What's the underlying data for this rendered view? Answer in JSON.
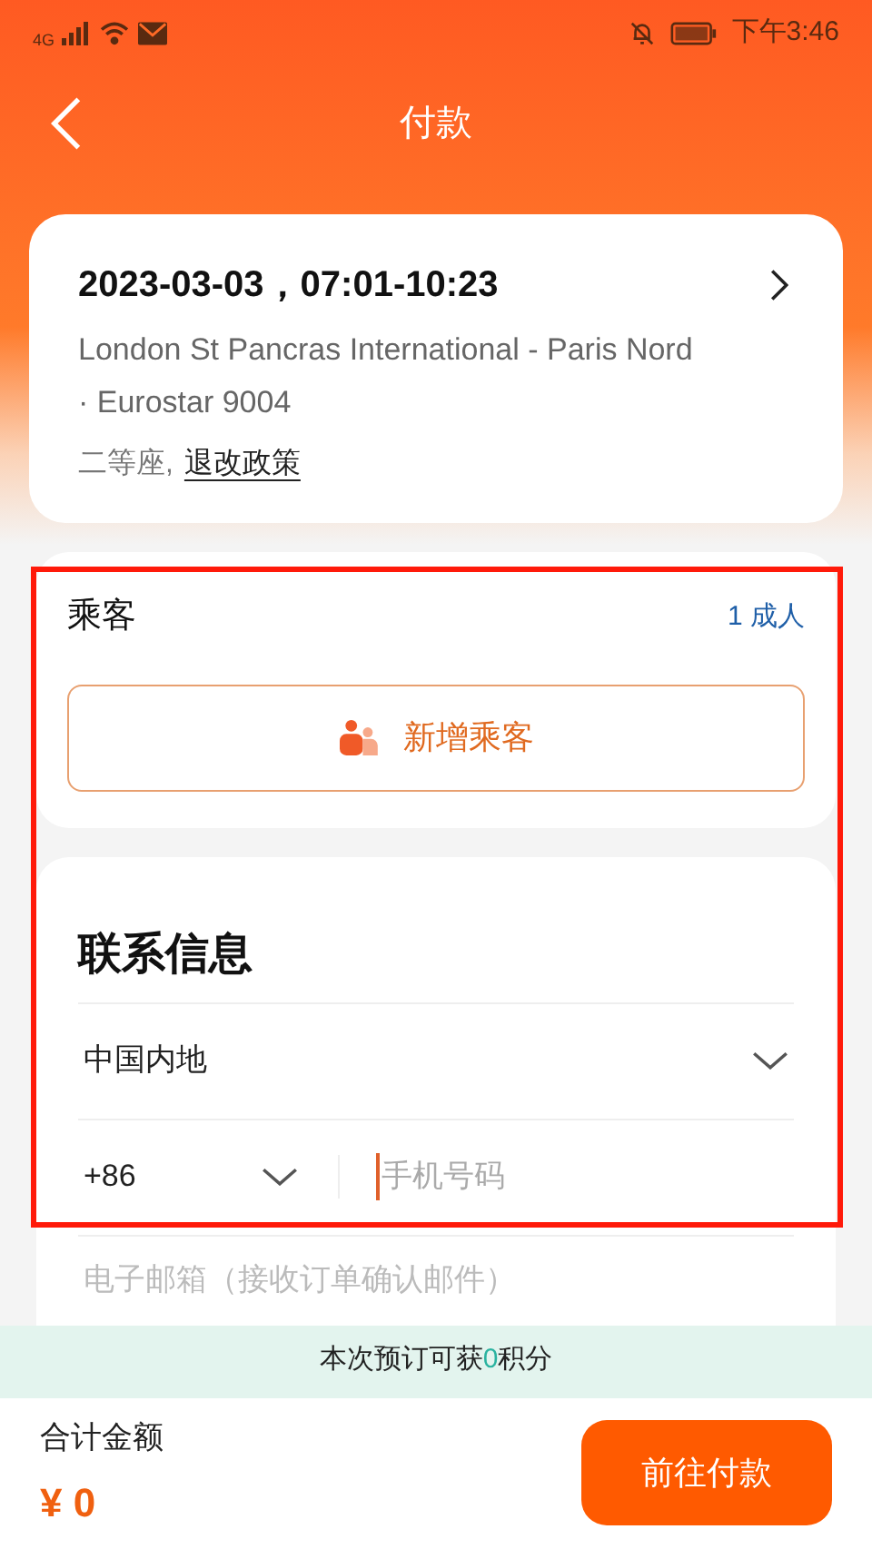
{
  "status_bar": {
    "network": "4G",
    "time": "下午3:46"
  },
  "nav": {
    "title": "付款"
  },
  "trip": {
    "datetime": "2023-03-03，07:01-10:23",
    "route": "London St Pancras International - Paris Nord · Eurostar 9004",
    "seat": "二等座,",
    "policy_link": "退改政策"
  },
  "passengers": {
    "title": "乘客",
    "count": "1 成人",
    "add_button": "新增乘客"
  },
  "contact": {
    "title": "联系信息",
    "region": "中国内地",
    "country_code": "+86",
    "phone_placeholder": "手机号码",
    "email_placeholder": "电子邮箱（接收订单确认邮件）"
  },
  "points_note": {
    "before": "本次预订可获",
    "points": "0",
    "after": "积分"
  },
  "footer": {
    "total_label": "合计金额",
    "total": "¥ 0",
    "pay_button": "前往付款"
  }
}
